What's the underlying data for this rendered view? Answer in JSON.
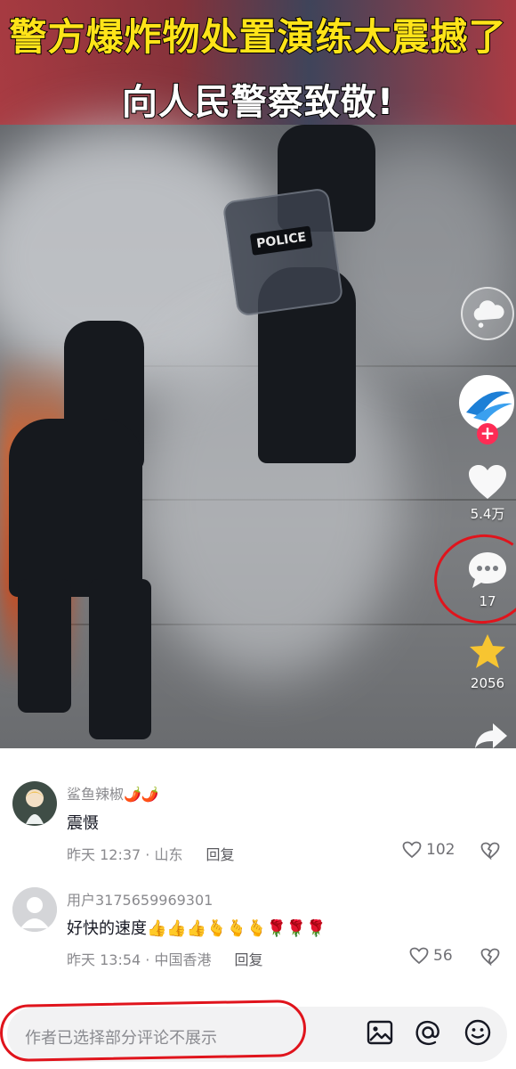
{
  "video": {
    "headline_line1": "警方爆炸物处置演练太震撼了",
    "headline_line2": "向人民警察致敬!",
    "shield_label": "POLICE"
  },
  "rail": {
    "like_count": "5.4万",
    "comment_count": "17",
    "favorite_count": "2056"
  },
  "comments": [
    {
      "username": "鲨鱼辣椒🌶️🌶️",
      "text": "震慑",
      "time": "昨天 12:37",
      "location": "山东",
      "reply_label": "回复",
      "likes": "102"
    },
    {
      "username": "用户3175659969301",
      "text": "好快的速度👍👍👍🫰🫰🫰🌹🌹🌹",
      "time": "昨天 13:54",
      "location": "中国香港",
      "reply_label": "回复",
      "likes": "56"
    }
  ],
  "comment_meta_sep": " · ",
  "input": {
    "placeholder": "作者已选择部分评论不展示"
  },
  "colors": {
    "accent_red": "#fe2c55",
    "annotation_red": "#e0141c",
    "headline_yellow": "#ffe419",
    "favorite_gold": "#f7c531"
  }
}
